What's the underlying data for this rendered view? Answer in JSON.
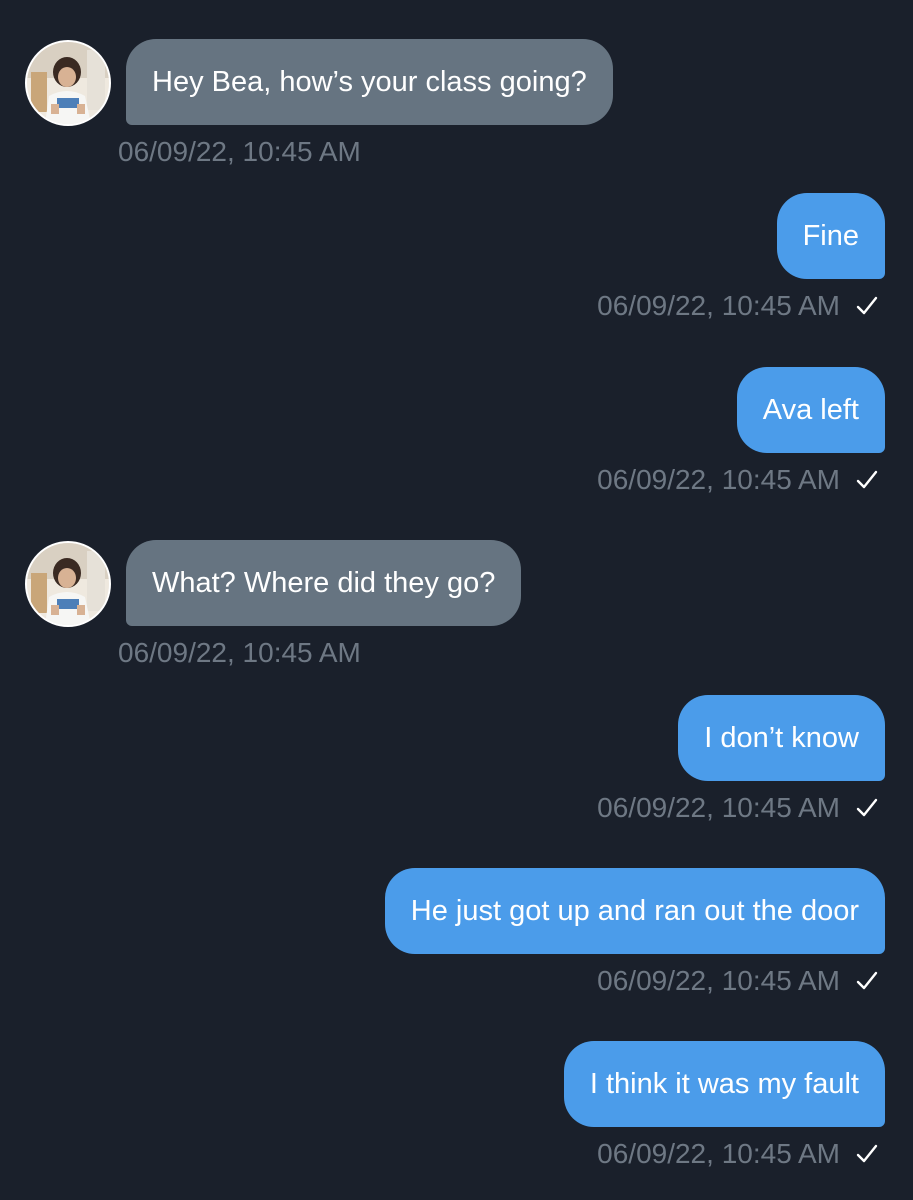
{
  "colors": {
    "background": "#1a202b",
    "incoming_bubble": "#667481",
    "outgoing_bubble": "#4b9cea",
    "timestamp": "#6e7884"
  },
  "messages": [
    {
      "direction": "in",
      "text": "Hey Bea, how’s your class going?",
      "timestamp": "06/09/22, 10:45 AM",
      "avatar": "contact-avatar"
    },
    {
      "direction": "out",
      "text": "Fine",
      "timestamp": "06/09/22, 10:45 AM",
      "status_icon": "checkmark-icon"
    },
    {
      "direction": "out",
      "text": "Ava left",
      "timestamp": "06/09/22, 10:45 AM",
      "status_icon": "checkmark-icon"
    },
    {
      "direction": "in",
      "text": "What? Where did they go?",
      "timestamp": "06/09/22, 10:45 AM",
      "avatar": "contact-avatar"
    },
    {
      "direction": "out",
      "text": "I don’t know",
      "timestamp": "06/09/22, 10:45 AM",
      "status_icon": "checkmark-icon"
    },
    {
      "direction": "out",
      "text": "He just got up and ran out the door",
      "timestamp": "06/09/22, 10:45 AM",
      "status_icon": "checkmark-icon"
    },
    {
      "direction": "out",
      "text": "I think it was my fault",
      "timestamp": "06/09/22, 10:45 AM",
      "status_icon": "checkmark-icon"
    }
  ]
}
